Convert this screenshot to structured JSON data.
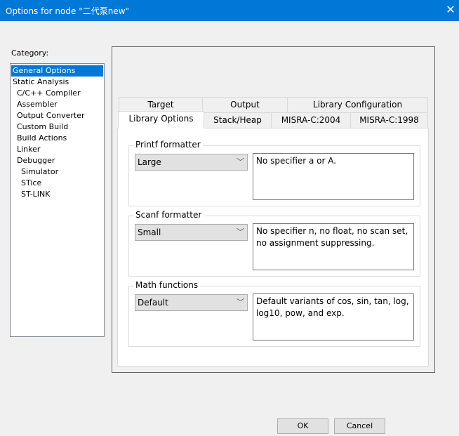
{
  "window": {
    "title": "Options for node \"二代泵new\"",
    "close_icon": "close-icon"
  },
  "category": {
    "label": "Category:",
    "items": [
      {
        "label": "General Options",
        "selected": true
      },
      {
        "label": "Static Analysis"
      },
      {
        "label": "C/C++ Compiler"
      },
      {
        "label": "Assembler"
      },
      {
        "label": "Output Converter"
      },
      {
        "label": "Custom Build"
      },
      {
        "label": "Build Actions"
      },
      {
        "label": "Linker"
      },
      {
        "label": "Debugger"
      },
      {
        "label": "Simulator"
      },
      {
        "label": "STice"
      },
      {
        "label": "ST-LINK"
      }
    ]
  },
  "tabs": {
    "row1": [
      "Target",
      "Output",
      "Library Configuration"
    ],
    "row2": [
      "Library Options",
      "Stack/Heap",
      "MISRA-C:2004",
      "MISRA-C:1998"
    ],
    "selected": "Library Options"
  },
  "groups": [
    {
      "title": "Printf formatter",
      "value": "Large",
      "description": "No specifier a or A."
    },
    {
      "title": "Scanf formatter",
      "value": "Small",
      "description": "No specifier n, no float, no scan set, no assignment suppressing."
    },
    {
      "title": "Math functions",
      "value": "Default",
      "description": "Default variants of cos, sin, tan, log, log10, pow, and exp."
    }
  ],
  "buttons": {
    "ok": "OK",
    "cancel": "Cancel"
  },
  "colors": {
    "accent": "#0078d7"
  }
}
